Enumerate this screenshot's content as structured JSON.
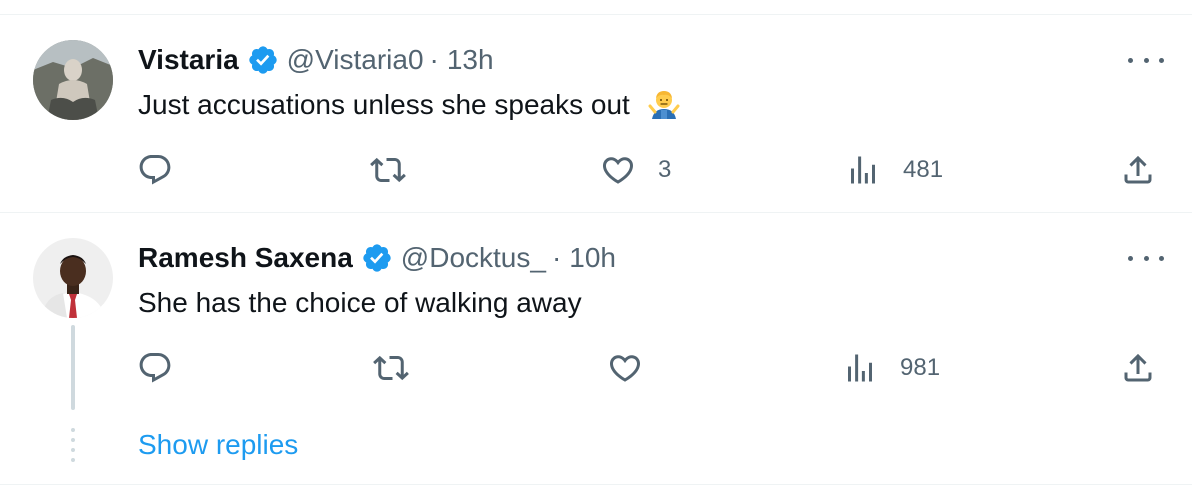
{
  "tweets": [
    {
      "name": "Vistaria",
      "handle": "@Vistaria0",
      "separator": "·",
      "time": "13h",
      "text": "Just accusations unless she speaks out",
      "emoji": "man-shrugging-emoji",
      "verified": true,
      "actions": {
        "reply": {
          "icon": "reply-icon",
          "count": ""
        },
        "retweet": {
          "icon": "retweet-icon",
          "count": ""
        },
        "like": {
          "icon": "heart-icon",
          "count": "3"
        },
        "views": {
          "icon": "views-icon",
          "count": "481"
        },
        "share": {
          "icon": "share-icon"
        }
      }
    },
    {
      "name": "Ramesh Saxena",
      "handle": "@Docktus_",
      "separator": "·",
      "time": "10h",
      "text": "She has the choice of walking away",
      "verified": true,
      "actions": {
        "reply": {
          "icon": "reply-icon",
          "count": ""
        },
        "retweet": {
          "icon": "retweet-icon",
          "count": ""
        },
        "like": {
          "icon": "heart-icon",
          "count": ""
        },
        "views": {
          "icon": "views-icon",
          "count": "981"
        },
        "share": {
          "icon": "share-icon"
        }
      }
    }
  ],
  "show_replies": "Show replies",
  "colors": {
    "accent": "#1d9bf0",
    "secondary_text": "#536471",
    "primary_text": "#0f1419",
    "divider": "#eff3f4"
  }
}
